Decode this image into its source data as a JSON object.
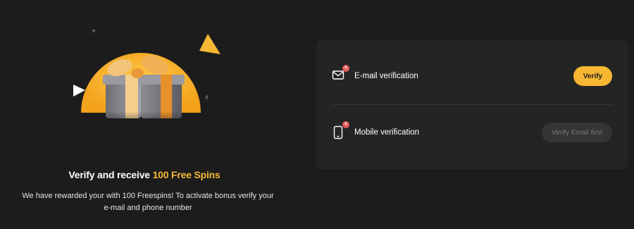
{
  "promo": {
    "title_prefix": "Verify and receive ",
    "title_highlight": "100 Free Spins",
    "text": "We have rewarded your with 100 Freespins! To activate bonus verify your e-mail and phone number",
    "gift_icon": "gift-box-illustration"
  },
  "verification": {
    "email": {
      "label": "E-mail verification",
      "icon": "envelope-icon",
      "status": "not-verified",
      "status_mark": "×",
      "button_label": "Verify"
    },
    "mobile": {
      "label": "Mobile verification",
      "icon": "phone-icon",
      "status": "not-verified",
      "status_mark": "×",
      "button_label": "Verify Email first"
    }
  },
  "colors": {
    "background": "#1c1c1c",
    "card": "#232523",
    "accent": "#f7b733",
    "status_error": "#e85a5a",
    "disabled_button": "#333533"
  }
}
